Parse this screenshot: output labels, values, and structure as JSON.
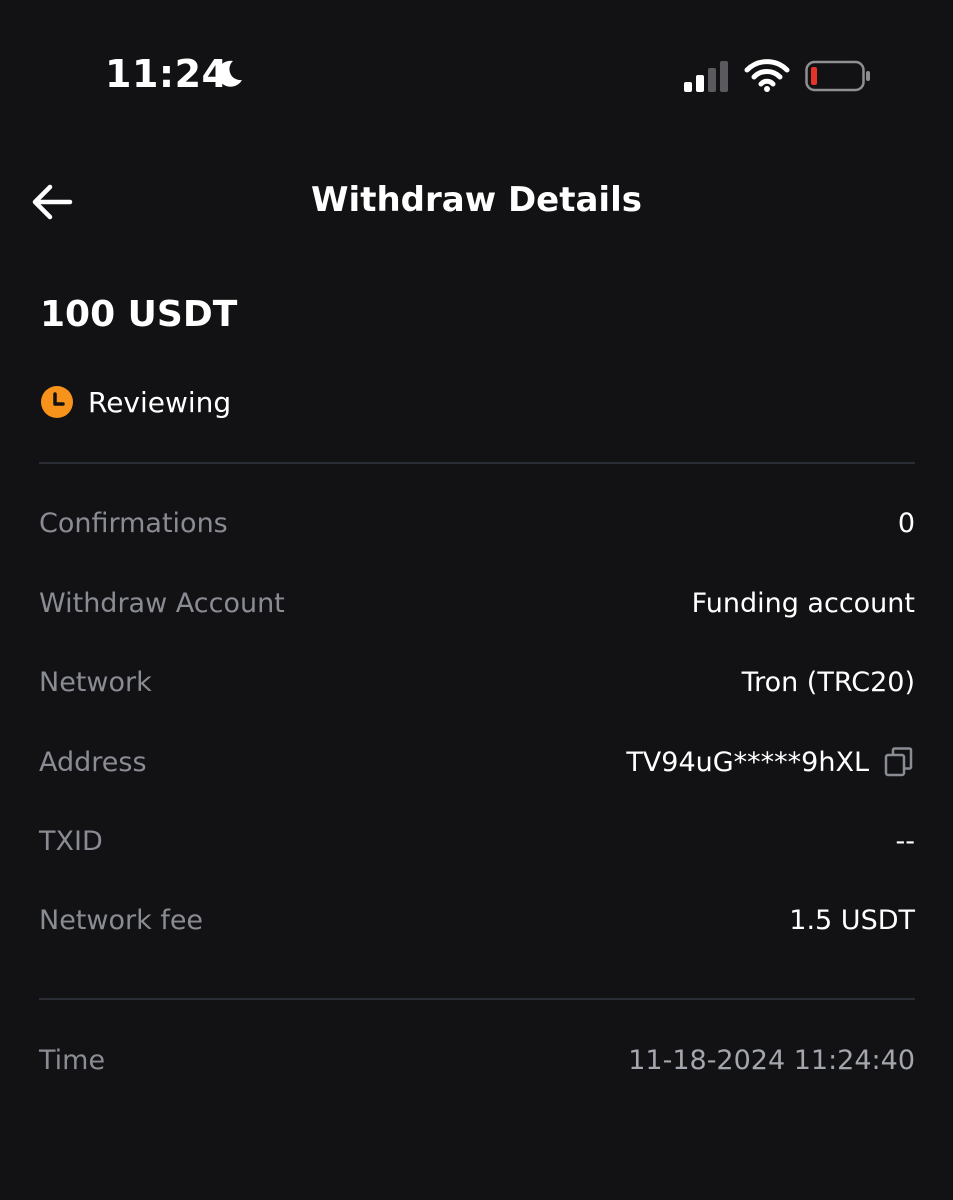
{
  "status_bar": {
    "time": "11:24",
    "icons": [
      "moon-icon",
      "signal-icon",
      "wifi-icon",
      "battery-icon"
    ]
  },
  "header": {
    "title": "Withdraw Details",
    "back_icon": "back-arrow-icon"
  },
  "summary": {
    "amount": "100 USDT",
    "status": "Reviewing",
    "status_icon": "clock-icon",
    "status_color": "#F7931A"
  },
  "details": [
    {
      "label": "Confirmations",
      "value": "0"
    },
    {
      "label": "Withdraw Account",
      "value": "Funding account"
    },
    {
      "label": "Network",
      "value": "Tron (TRC20)"
    },
    {
      "label": "Address",
      "value": "TV94uG*****9hXL",
      "icon": "copy-icon"
    },
    {
      "label": "TXID",
      "value": "--"
    },
    {
      "label": "Network fee",
      "value": "1.5 USDT"
    }
  ],
  "time_row": {
    "label": "Time",
    "value": "11-18-2024 11:24:40"
  },
  "colors": {
    "background": "#121214",
    "label": "#8a8c93",
    "divider": "#2a2d36",
    "battery_low": "#E5332A"
  }
}
